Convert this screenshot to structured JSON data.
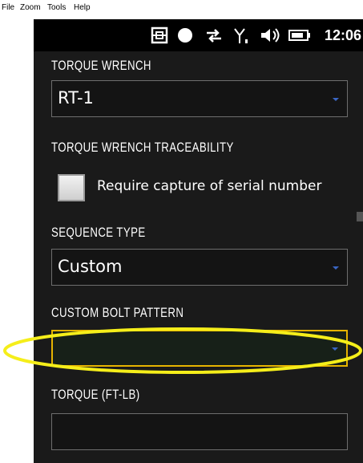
{
  "menu": {
    "items": [
      "File",
      "Zoom",
      "Tools",
      "Help"
    ]
  },
  "statusbar": {
    "icons": [
      "window-icon",
      "record-dot-icon",
      "sync-arrows-icon",
      "signal-icon",
      "volume-icon",
      "battery-icon"
    ],
    "time": "12:06"
  },
  "torque_wrench": {
    "label": "TORQUE WRENCH",
    "value": "RT-1"
  },
  "traceability": {
    "label": "TORQUE WRENCH TRACEABILITY",
    "checkbox_label": "Require capture of serial number",
    "checked": false
  },
  "sequence_type": {
    "label": "SEQUENCE TYPE",
    "value": "Custom"
  },
  "custom_bolt_pattern": {
    "label": "CUSTOM BOLT PATTERN",
    "value": ""
  },
  "torque": {
    "label": "TORQUE (FT-LB)",
    "value": ""
  },
  "colors": {
    "focus_border": "#e6b400",
    "annotation_ellipse": "#f5ee1a",
    "dropdown_arrow": "#3a66c4"
  }
}
